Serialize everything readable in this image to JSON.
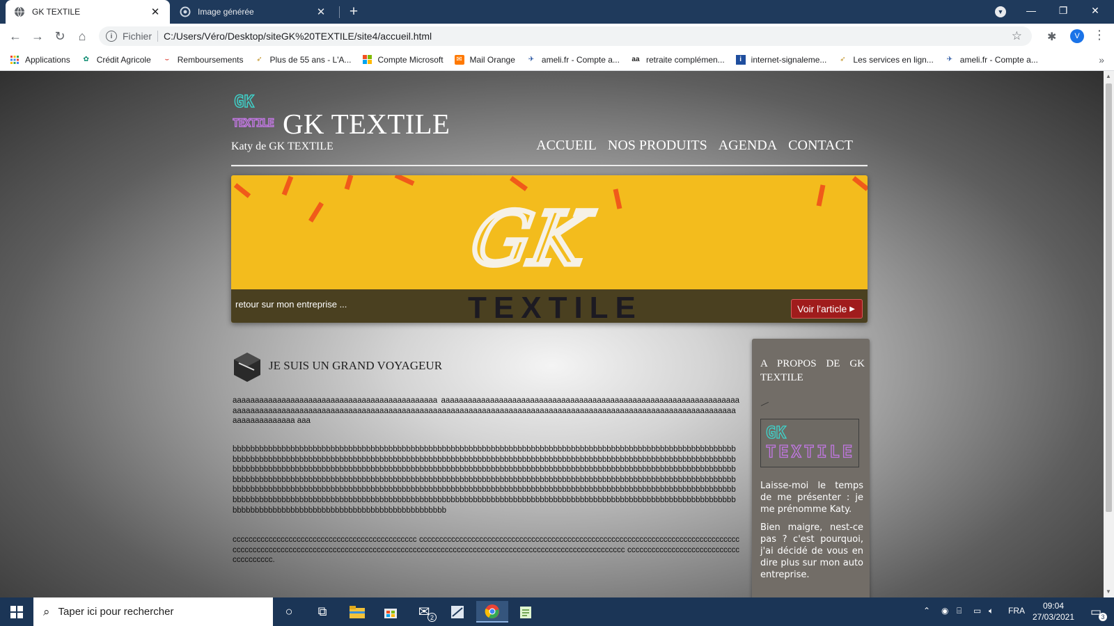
{
  "browser": {
    "tabs": [
      {
        "title": "GK TEXTILE",
        "active": true
      },
      {
        "title": "Image générée",
        "active": false
      }
    ],
    "address": {
      "scheme_label": "Fichier",
      "url": "C:/Users/Véro/Desktop/siteGK%20TEXTILE/site4/accueil.html"
    },
    "profile_initial": "V",
    "bookmarks": [
      {
        "label": "Applications",
        "icon": "apps-grid-icon"
      },
      {
        "label": "Crédit Agricole",
        "icon": "credit-agricole-icon"
      },
      {
        "label": "Remboursements",
        "icon": "remboursements-icon"
      },
      {
        "label": "Plus de 55 ans - L'A...",
        "icon": "plus-55-icon"
      },
      {
        "label": "Compte Microsoft",
        "icon": "microsoft-icon"
      },
      {
        "label": "Mail Orange",
        "icon": "mail-orange-icon"
      },
      {
        "label": "ameli.fr - Compte a...",
        "icon": "ameli-icon"
      },
      {
        "label": "retraite complémen...",
        "icon": "retraite-icon"
      },
      {
        "label": "internet-signaleme...",
        "icon": "internet-signalement-icon"
      },
      {
        "label": "Les services en lign...",
        "icon": "services-en-ligne-icon"
      },
      {
        "label": "ameli.fr - Compte a...",
        "icon": "ameli-icon"
      }
    ]
  },
  "site": {
    "logo_text": "GK TEXTILE",
    "title": "GK TEXTILE",
    "subtitle": "Katy de GK TEXTILE",
    "nav": [
      "ACCUEIL",
      "NOS PRODUITS",
      "AGENDA",
      "CONTACT"
    ],
    "banner": {
      "script_text": "GK",
      "big_text": "TEXTILE",
      "caption": "retour sur mon entreprise ...",
      "button_label": "Voir l'article"
    },
    "main": {
      "heading": "JE SUIS UN GRAND VOYAGEUR",
      "paragraphs": [
        "aaaaaaaaaaaaaaaaaaaaaaaaaaaaaaaaaaaaaaaaaaaaaa aaaaaaaaaaaaaaaaaaaaaaaaaaaaaaaaaaaaaaaaaaaaaaaaaaaaaaaaaaaaaaaaaaaaaaaaaaaaaaaaaaaaaaaaaaaaaaaaaaaaaaaaaaaaaaaaaaaaaaaaaaaaaaaaaaaaaaaaaaaaaaaaaaaaaaaaaaaaaaaaaaaaaaaaaaaaaaaaaaaaaaaaaaaaaaaaaa aaa",
        "bbbbbbbbbbbbbbbbbbbbbbbbbbbbbbbbbbbbbbbbbbbbbbbbbbbbbbbbbbbbbbbbbbbbbbbbbbbbbbbbbbbbbbbbbbbbbbbbbbbbbbbbbbbbbbbbbbbbbbbbbbbbbbbbbbbbbbbbbbbbbbbbbbbbbbbbbbbbbbbbbbbbbbbbbbbbbbbbbbbbbbbbbbbbbbbbbbbbbbbbbbbbbbbbbbbbbbbbbbbbbbbbbbbbbbbbbbbbbbbbbbbbbbbbbbbbbbbbbbbbbbbbbbbbbbbbbbbbbbbbbbbbbbbbbbbbbbbbbbbbbbbbbbbbbbbbbbbbbbbbbbbbbbbbbbbbbbbbbbbbbbbbbbbbbbbbbbbbbbbbbbbbbbbbbbbbbbbbbbbbbbbbbbbbbbbbbbbbbbbbbbbbbbbbbbbbbbbbbbbbbbbbbbbbbbbbbbbbbbbbbbbbbbbbbbbbbbbbbbbbbbbbbbbbbbbbbbbbbbbbbbbbbbbbbbbbbbbbbbbbbbbbbbbbbbbbbbbbbbbbbbbbbbbbbbbbbbbbbbbbbbbbbbbbbbbbbbbbbbbbbbbbbbbbbbbbbbbbbbbbbbbbbbbbbbbbbbbbbbbbbbbbbbbbbbbbbbbbbbbbbbbbbbbbbbbbbbbbbbbbbbbbbbbbbbbbbbbbbbbbbbbbbbbbbbbbbbbbbbbbbbbbbbbbbbbbbbbbbbbbbbbbbbbbbbbbbbbbbbbbbbbbbb",
        "cccccccccccccccccccccccccccccccccccccccccccccc cccccccccccccccccccccccccccccccccccccccccccccccccccccccccccccccccccccccccccccccccccccccccccccccccccccccccccccccccccccccccccccccccccccccccccccccccccccccccccccccccccccccccccccccccc cccccccccccccccccccccccccccccccccccccc."
      ]
    },
    "sidebar": {
      "title": "A PROPOS DE GK TEXTILE",
      "logo_text": "GK TEXTILE",
      "paragraphs": [
        "Laisse-moi le temps de me présenter : je me prénomme Katy.",
        "Bien maigre, nest-ce pas ? c'est pourquoi, j'ai décidé de vous en dire plus sur mon auto entreprise."
      ]
    }
  },
  "taskbar": {
    "search_placeholder": "Taper ici pour rechercher",
    "mail_badge": "2",
    "language": "FRA",
    "time": "09:04",
    "date": "27/03/2021",
    "notification_count": "3"
  }
}
